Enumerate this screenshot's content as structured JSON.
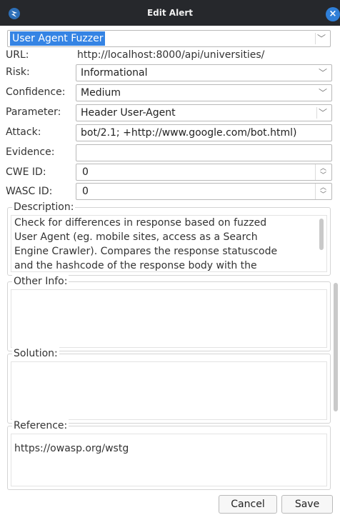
{
  "window": {
    "title": "Edit Alert",
    "close_icon": "×"
  },
  "alert": {
    "name": "User Agent Fuzzer",
    "url_label": "URL:",
    "url": "http://localhost:8000/api/universities/",
    "risk_label": "Risk:",
    "risk": "Informational",
    "confidence_label": "Confidence:",
    "confidence": "Medium",
    "parameter_label": "Parameter:",
    "parameter": "Header User-Agent",
    "attack_label": "Attack:",
    "attack": "bot/2.1; +http://www.google.com/bot.html)",
    "evidence_label": "Evidence:",
    "evidence": "",
    "cwe_label": "CWE ID:",
    "cwe": "0",
    "wasc_label": "WASC ID:",
    "wasc": "0"
  },
  "sections": {
    "description_label": "Description:",
    "description_lines": [
      "Check for differences in response based on fuzzed",
      "User Agent (eg. mobile sites, access as a Search",
      "Engine Crawler). Compares the response statuscode",
      "and the hashcode of the response body with the"
    ],
    "other_info_label": "Other Info:",
    "other_info": "",
    "solution_label": "Solution:",
    "solution": "",
    "reference_label": "Reference:",
    "reference": "https://owasp.org/wstg"
  },
  "buttons": {
    "cancel": "Cancel",
    "save": "Save"
  },
  "colors": {
    "titlebar": "#26282c",
    "selection": "#3584e4",
    "close_button": "#2f7fd8"
  }
}
